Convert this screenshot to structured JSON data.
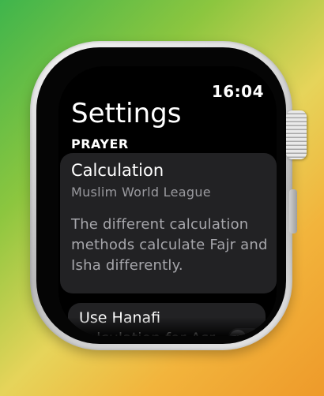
{
  "status": {
    "time": "16:04"
  },
  "header": {
    "title": "Settings"
  },
  "prayer": {
    "section_label": "PRAYER",
    "calculation": {
      "label": "Calculation",
      "value": "Muslim World League",
      "description": "The different calculation methods calculate Fajr and Isha differently."
    },
    "hanafi": {
      "label": "Use Hanafi calculation for Asr",
      "enabled": false
    }
  },
  "colors": {
    "screen_bg": "#000000",
    "card_bg": "#222224",
    "secondary_text": "#9a9a9f",
    "toggle_off": "#3a3a3c"
  }
}
